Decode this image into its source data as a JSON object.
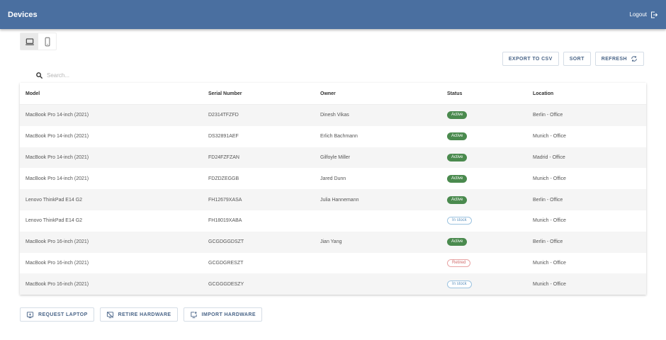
{
  "appbar": {
    "title": "Devices",
    "logout_label": "Logout"
  },
  "toggle": {
    "laptop_icon": "laptop-icon",
    "phone_icon": "phone-icon"
  },
  "actions": {
    "export_label": "EXPORT TO CSV",
    "sort_label": "SORT",
    "refresh_label": "REFRESH"
  },
  "search": {
    "placeholder": "Search..."
  },
  "table": {
    "headers": {
      "model": "Model",
      "serial": "Serial Number",
      "owner": "Owner",
      "status": "Status",
      "location": "Location"
    },
    "rows": [
      {
        "model": "MacBook Pro 14-inch (2021)",
        "serial": "D2314TFZFD",
        "owner": "Dinesh Vikas",
        "status": "Active",
        "location": "Berlin - Office"
      },
      {
        "model": "MacBook Pro 14-inch (2021)",
        "serial": "DS32891AEF",
        "owner": "Erlich Bachmann",
        "status": "Active",
        "location": "Munich - Office"
      },
      {
        "model": "MacBook Pro 14-inch (2021)",
        "serial": "FD24FZFZAN",
        "owner": "Gilfoyle Miller",
        "status": "Active",
        "location": "Madrid - Office"
      },
      {
        "model": "MacBook Pro 14-inch (2021)",
        "serial": "FDZDZEGGB",
        "owner": "Jared Dunn",
        "status": "Active",
        "location": "Munich - Office"
      },
      {
        "model": "Lenovo ThinkPad E14 G2",
        "serial": "FH12679XASA",
        "owner": "Julia Hannemann",
        "status": "Active",
        "location": "Berlin - Office"
      },
      {
        "model": "Lenovo ThinkPad E14 G2",
        "serial": "FH18019XABA",
        "owner": "",
        "status": "In stock",
        "location": "Munich - Office"
      },
      {
        "model": "MacBook Pro 16-inch (2021)",
        "serial": "GCGDGGDSZT",
        "owner": "Jian Yang",
        "status": "Active",
        "location": "Berlin - Office"
      },
      {
        "model": "MacBook Pro 16-inch (2021)",
        "serial": "GCGDGRESZT",
        "owner": "",
        "status": "Retired",
        "location": "Munich - Office"
      },
      {
        "model": "MacBook Pro 16-inch (2021)",
        "serial": "GCGGGDESZY",
        "owner": "",
        "status": "In stock",
        "location": "Munich - Office"
      }
    ]
  },
  "bottom": {
    "request_label": "REQUEST LAPTOP",
    "retire_label": "RETIRE HARDWARE",
    "import_label": "IMPORT HARDWARE"
  },
  "colors": {
    "appbar": "#4a6fa0",
    "active": "#4a8a4e",
    "in_stock": "#5f93bf",
    "retired": "#d06b6b"
  }
}
